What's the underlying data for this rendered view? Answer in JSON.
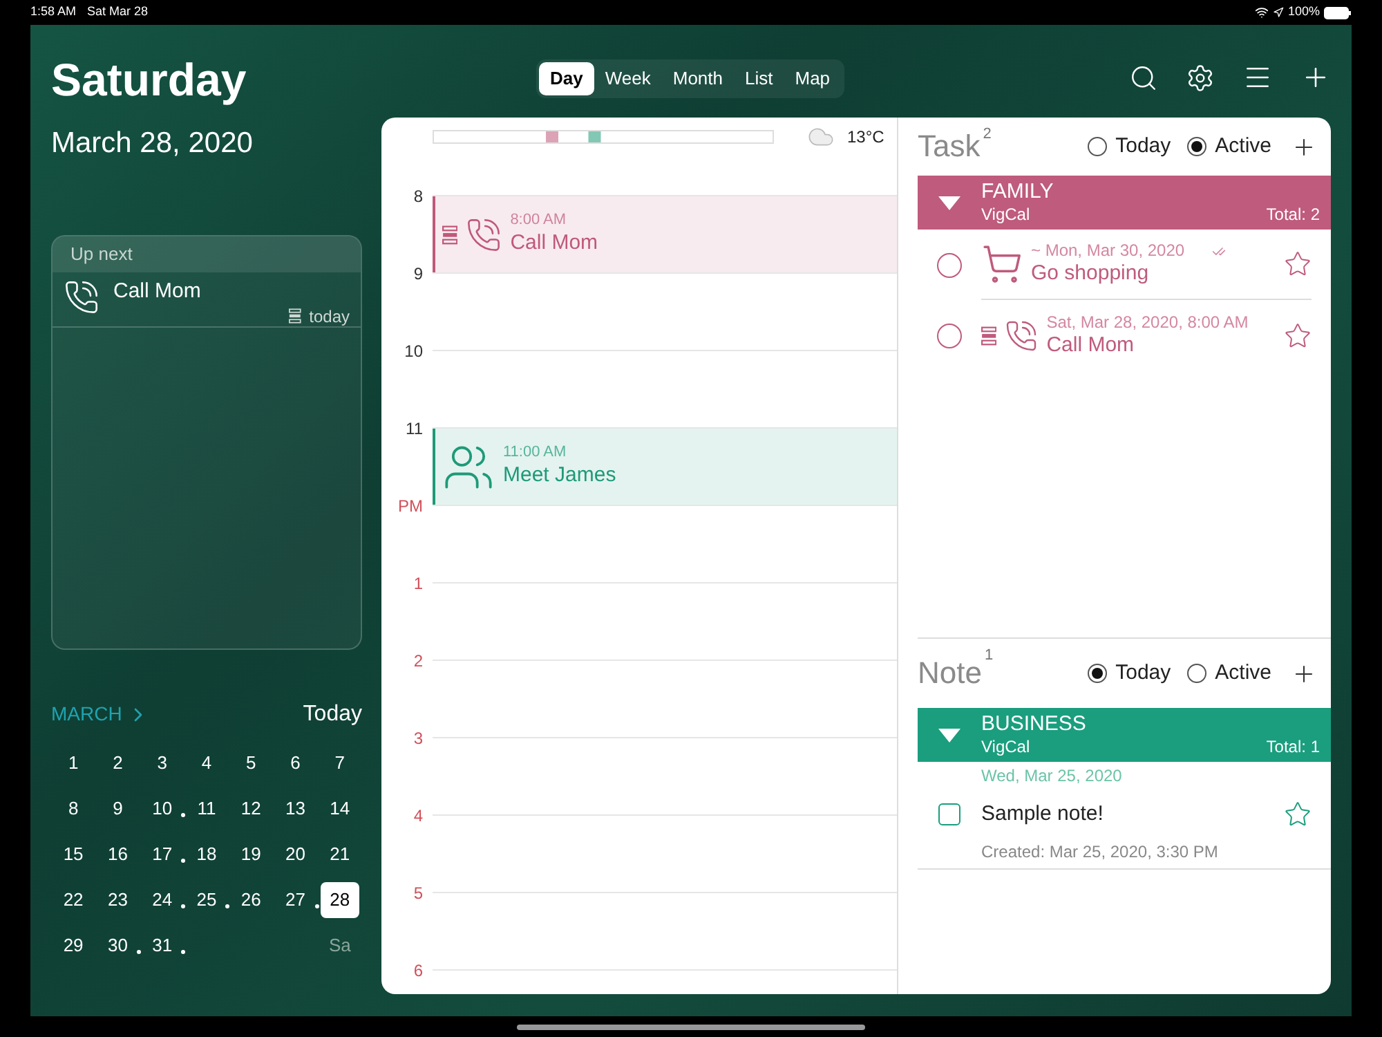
{
  "status_bar": {
    "time": "1:58 AM",
    "date": "Sat Mar 28",
    "battery": "100%"
  },
  "header": {
    "weekday": "Saturday",
    "date": "March 28, 2020"
  },
  "view_tabs": [
    {
      "label": "Day",
      "selected": true
    },
    {
      "label": "Week",
      "selected": false
    },
    {
      "label": "Month",
      "selected": false
    },
    {
      "label": "List",
      "selected": false
    },
    {
      "label": "Map",
      "selected": false
    }
  ],
  "up_next": {
    "title": "Up next",
    "items": [
      {
        "title": "Call Mom",
        "when": "today",
        "kind": "call"
      }
    ]
  },
  "mini_calendar": {
    "month": "MARCH",
    "today_button": "Today",
    "weekday_hint": "Sa",
    "days": [
      {
        "day": "1",
        "dot": false,
        "selected": false
      },
      {
        "day": "2",
        "dot": false,
        "selected": false
      },
      {
        "day": "3",
        "dot": false,
        "selected": false
      },
      {
        "day": "4",
        "dot": false,
        "selected": false
      },
      {
        "day": "5",
        "dot": false,
        "selected": false
      },
      {
        "day": "6",
        "dot": false,
        "selected": false
      },
      {
        "day": "7",
        "dot": false,
        "selected": false
      },
      {
        "day": "8",
        "dot": false,
        "selected": false
      },
      {
        "day": "9",
        "dot": false,
        "selected": false
      },
      {
        "day": "10",
        "dot": true,
        "selected": false
      },
      {
        "day": "11",
        "dot": false,
        "selected": false
      },
      {
        "day": "12",
        "dot": false,
        "selected": false
      },
      {
        "day": "13",
        "dot": false,
        "selected": false
      },
      {
        "day": "14",
        "dot": false,
        "selected": false
      },
      {
        "day": "15",
        "dot": false,
        "selected": false
      },
      {
        "day": "16",
        "dot": false,
        "selected": false
      },
      {
        "day": "17",
        "dot": true,
        "selected": false
      },
      {
        "day": "18",
        "dot": false,
        "selected": false
      },
      {
        "day": "19",
        "dot": false,
        "selected": false
      },
      {
        "day": "20",
        "dot": false,
        "selected": false
      },
      {
        "day": "21",
        "dot": false,
        "selected": false
      },
      {
        "day": "22",
        "dot": false,
        "selected": false
      },
      {
        "day": "23",
        "dot": false,
        "selected": false
      },
      {
        "day": "24",
        "dot": true,
        "selected": false
      },
      {
        "day": "25",
        "dot": true,
        "selected": false
      },
      {
        "day": "26",
        "dot": false,
        "selected": false
      },
      {
        "day": "27",
        "dot": true,
        "selected": false
      },
      {
        "day": "28",
        "dot": false,
        "selected": true
      },
      {
        "day": "29",
        "dot": false,
        "selected": false
      },
      {
        "day": "30",
        "dot": true,
        "selected": false
      },
      {
        "day": "31",
        "dot": true,
        "selected": false
      }
    ]
  },
  "day_view": {
    "weather": "13°C",
    "hours": [
      {
        "label": "8",
        "pm": false,
        "events": [
          {
            "time": "8:00 AM",
            "title": "Call Mom",
            "color": "#c0587a",
            "kind": "call",
            "has_details": true
          }
        ]
      },
      {
        "label": "9",
        "pm": false
      },
      {
        "label": "10",
        "pm": false
      },
      {
        "label": "11",
        "pm": false,
        "events": [
          {
            "time": "11:00 AM",
            "title": "Meet James",
            "color": "#1e9a79",
            "kind": "meeting",
            "has_details": false
          }
        ]
      },
      {
        "label": "PM",
        "pm": true
      },
      {
        "label": "1",
        "pm": true
      },
      {
        "label": "2",
        "pm": true
      },
      {
        "label": "3",
        "pm": true
      },
      {
        "label": "4",
        "pm": true
      },
      {
        "label": "5",
        "pm": true
      },
      {
        "label": "6",
        "pm": true
      }
    ]
  },
  "tasks": {
    "title": "Task",
    "count": "2",
    "filters": [
      {
        "label": "Today",
        "selected": false
      },
      {
        "label": "Active",
        "selected": true
      }
    ],
    "group": {
      "name": "FAMILY",
      "source": "VigCal",
      "total": "Total: 2",
      "color": "#bf5b7c",
      "expanded": true
    },
    "items": [
      {
        "date": "~ Mon, Mar 30, 2020",
        "title": "Go shopping",
        "kind": "shopping",
        "has_details": false,
        "checked": false,
        "starred": false,
        "subtasks": true
      },
      {
        "date": "Sat, Mar 28, 2020, 8:00 AM",
        "title": "Call Mom",
        "kind": "call",
        "has_details": true,
        "checked": false,
        "starred": false,
        "subtasks": false
      }
    ]
  },
  "notes": {
    "title": "Note",
    "count": "1",
    "filters": [
      {
        "label": "Today",
        "selected": true
      },
      {
        "label": "Active",
        "selected": false
      }
    ],
    "group": {
      "name": "BUSINESS",
      "source": "VigCal",
      "total": "Total: 1",
      "color": "#1a9e7e",
      "expanded": true
    },
    "date": "Wed, Mar 25, 2020",
    "items": [
      {
        "title": "Sample note!",
        "created": "Created: Mar 25, 2020, 3:30 PM",
        "checked": false,
        "starred": false
      }
    ]
  }
}
